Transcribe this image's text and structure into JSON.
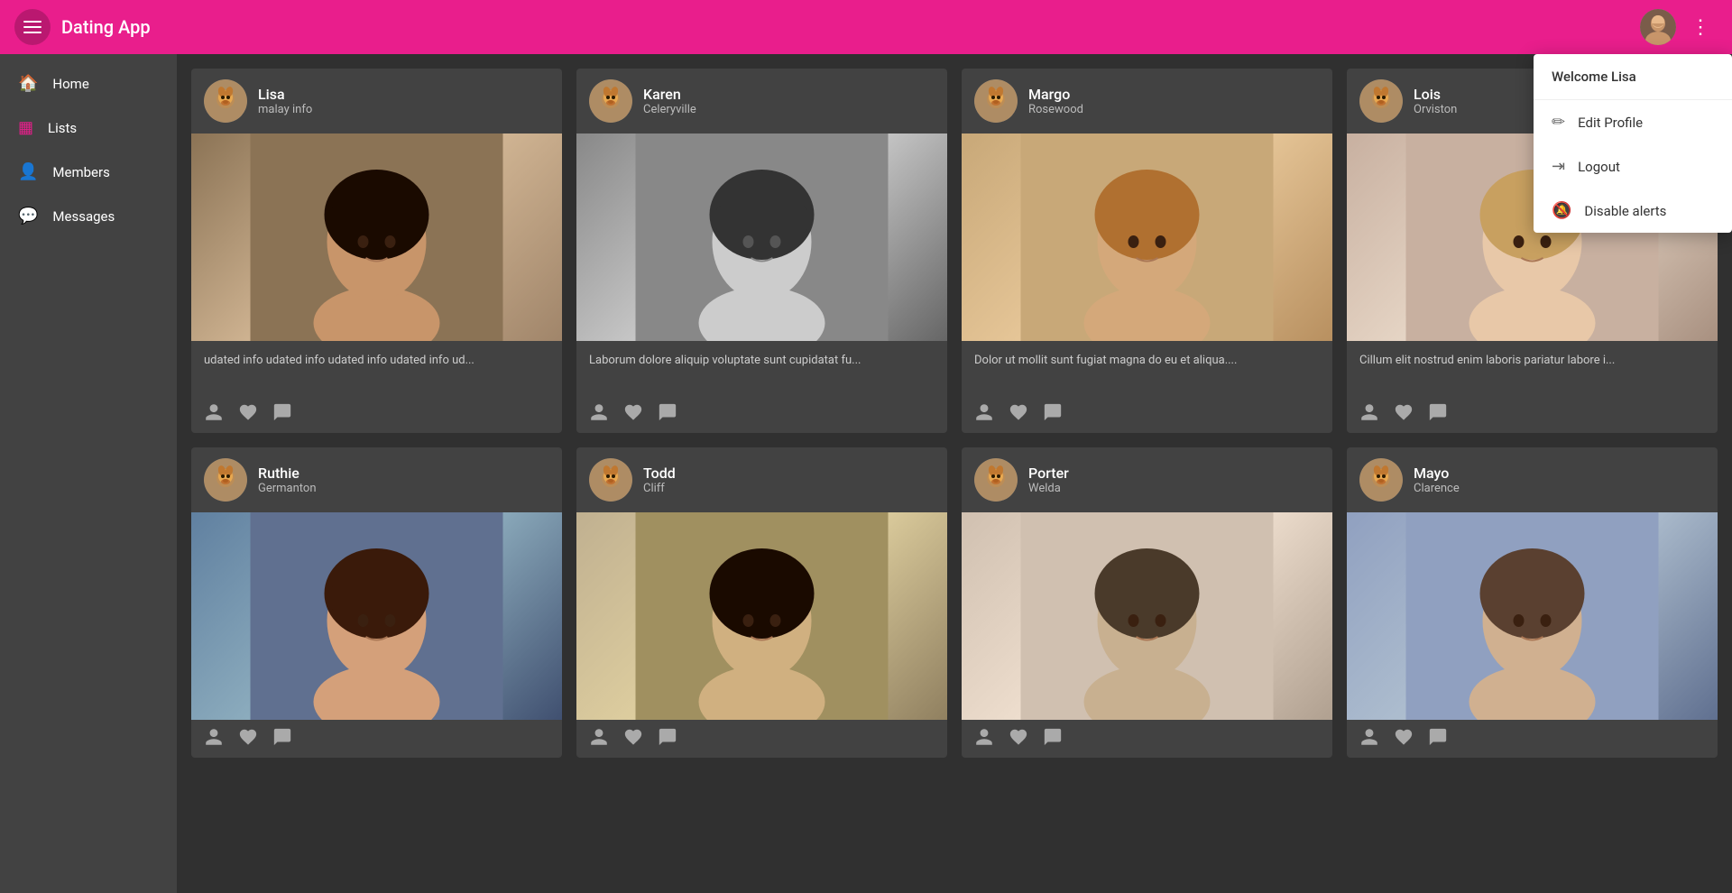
{
  "app": {
    "title": "Dating App"
  },
  "topbar": {
    "title": "Dating App",
    "user_welcome": "Welcome Lisa"
  },
  "sidebar": {
    "items": [
      {
        "id": "home",
        "label": "Home",
        "icon": "🏠"
      },
      {
        "id": "lists",
        "label": "Lists",
        "icon": "☰"
      },
      {
        "id": "members",
        "label": "Members",
        "icon": "👤"
      },
      {
        "id": "messages",
        "label": "Messages",
        "icon": "💬"
      }
    ]
  },
  "dropdown": {
    "welcome": "Welcome Lisa",
    "items": [
      {
        "id": "edit-profile",
        "label": "Edit Profile",
        "icon": "✏️"
      },
      {
        "id": "logout",
        "label": "Logout",
        "icon": "➡️"
      },
      {
        "id": "disable-alerts",
        "label": "Disable alerts",
        "icon": "🔔"
      }
    ]
  },
  "members": [
    {
      "id": "lisa",
      "name": "Lisa",
      "location": "malay info",
      "description": "udated info udated info udated info udated info ud...",
      "photo_class": "photo-lisa"
    },
    {
      "id": "karen",
      "name": "Karen",
      "location": "Celeryville",
      "description": "Laborum dolore aliquip voluptate sunt cupidatat fu...",
      "photo_class": "photo-karen"
    },
    {
      "id": "margo",
      "name": "Margo",
      "location": "Rosewood",
      "description": "Dolor ut mollit sunt fugiat magna do eu et aliqua....",
      "photo_class": "photo-margo"
    },
    {
      "id": "lois",
      "name": "Lois",
      "location": "Orviston",
      "description": "Cillum elit nostrud enim laboris pariatur labore i...",
      "photo_class": "photo-lois"
    },
    {
      "id": "ruthie",
      "name": "Ruthie",
      "location": "Germanton",
      "description": "",
      "photo_class": "photo-ruthie"
    },
    {
      "id": "todd",
      "name": "Todd",
      "location": "Cliff",
      "description": "",
      "photo_class": "photo-todd"
    },
    {
      "id": "porter",
      "name": "Porter",
      "location": "Welda",
      "description": "",
      "photo_class": "photo-porter"
    },
    {
      "id": "mayo",
      "name": "Mayo",
      "location": "Clarence",
      "description": "",
      "photo_class": "photo-mayo"
    }
  ]
}
